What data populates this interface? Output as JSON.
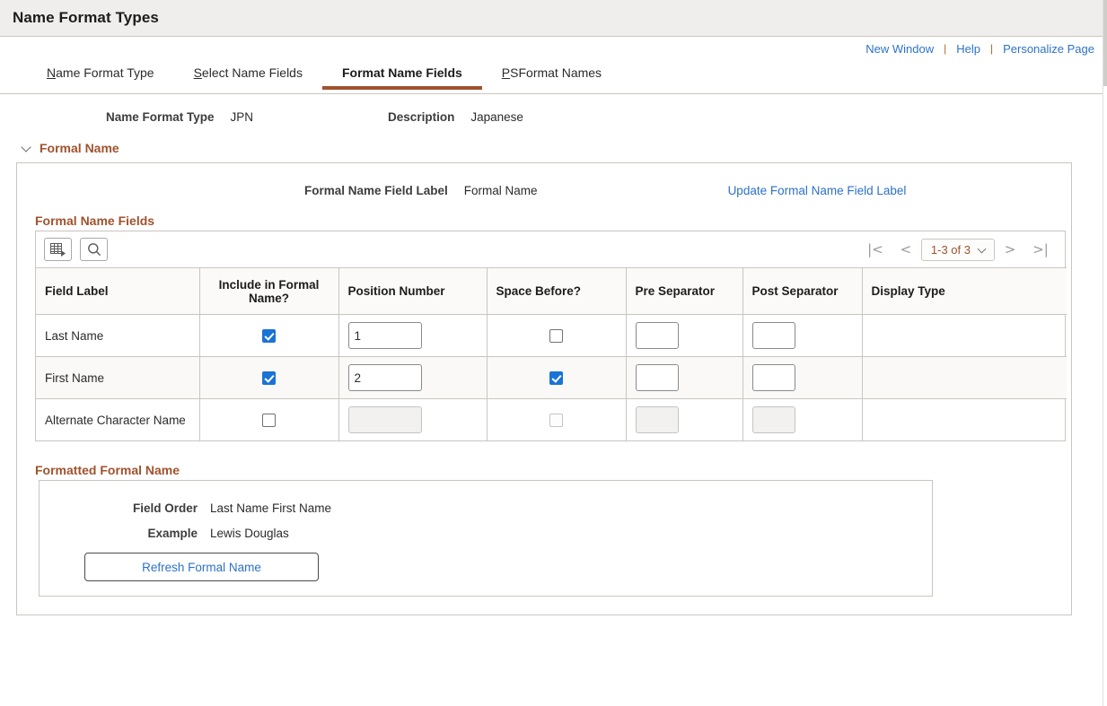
{
  "header": {
    "title": "Name Format Types"
  },
  "utility_links": [
    {
      "label": "New Window",
      "name": "new-window-link"
    },
    {
      "label": "Help",
      "name": "help-link"
    },
    {
      "label": "Personalize Page",
      "name": "personalize-page-link"
    }
  ],
  "util_separator": "|",
  "tabs": [
    {
      "label": "Name Format Type",
      "accel": "N",
      "rest": "ame Format Type",
      "active": false
    },
    {
      "label": "Select Name Fields",
      "accel": "S",
      "rest": "elect Name Fields",
      "active": false
    },
    {
      "label": "Format Name Fields",
      "accel": "",
      "rest": "Format Name Fields",
      "active": true
    },
    {
      "label": "PSFormat Names",
      "accel": "P",
      "rest": "SFormat Names",
      "active": false
    }
  ],
  "top_fields": {
    "name_format_type_label": "Name Format Type",
    "name_format_type_value": "JPN",
    "description_label": "Description",
    "description_value": "Japanese"
  },
  "section": {
    "title": "Formal Name",
    "field_label_caption": "Formal Name Field Label",
    "field_label_value": "Formal Name",
    "update_link": "Update Formal Name Field Label"
  },
  "grid": {
    "title": "Formal Name Fields",
    "toolbar": {
      "personalize_icon": "grid-personalize-icon",
      "find_icon": "search-icon"
    },
    "pager": {
      "first": "|<",
      "prev": "<",
      "range": "1-3 of 3",
      "next": ">",
      "last": ">|"
    },
    "columns": [
      "Field Label",
      "Include in Formal Name?",
      "Position Number",
      "Space Before?",
      "Pre Separator",
      "Post Separator",
      "Display Type"
    ],
    "rows": [
      {
        "field_label": "Last Name",
        "include": true,
        "include_disabled": false,
        "position": "1",
        "position_disabled": false,
        "space_before": false,
        "space_before_disabled": false,
        "pre_separator": "",
        "post_separator": "",
        "separators_disabled": false,
        "display_type": ""
      },
      {
        "field_label": "First Name",
        "include": true,
        "include_disabled": false,
        "position": "2",
        "position_disabled": false,
        "space_before": true,
        "space_before_disabled": false,
        "pre_separator": "",
        "post_separator": "",
        "separators_disabled": false,
        "display_type": ""
      },
      {
        "field_label": "Alternate Character Name",
        "include": false,
        "include_disabled": false,
        "position": "",
        "position_disabled": true,
        "space_before": false,
        "space_before_disabled": true,
        "pre_separator": "",
        "post_separator": "",
        "separators_disabled": true,
        "display_type": ""
      }
    ]
  },
  "formatted": {
    "title": "Formatted Formal Name",
    "field_order_label": "Field Order",
    "field_order_value": "Last Name First Name",
    "example_label": "Example",
    "example_value": "Lewis Douglas",
    "refresh_button": "Refresh Formal Name"
  },
  "colors": {
    "accent_brown": "#a0522d",
    "link_blue": "#2d72c7",
    "checkbox_blue": "#1a73d6",
    "header_bg": "#efeeec",
    "border": "#c9c6c1"
  }
}
